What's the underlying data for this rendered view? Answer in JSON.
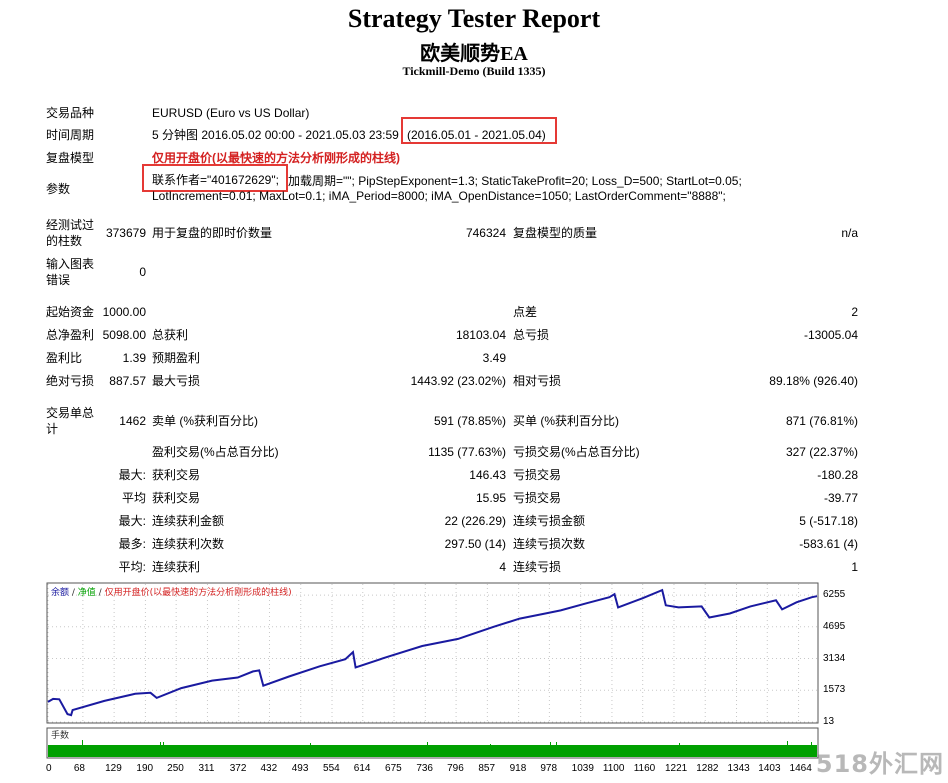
{
  "header": {
    "title": "Strategy Tester Report",
    "subtitle": "欧美顺势EA",
    "server": "Tickmill-Demo (Build 1335)"
  },
  "info": {
    "symbol_label": "交易品种",
    "symbol_value": "EURUSD (Euro vs US Dollar)",
    "period_label": "时间周期",
    "period_value": "5 分钟图 2016.05.02 00:00 - 2021.05.03 23:59",
    "period_highlight": "(2016.05.01 - 2021.05.04)",
    "model_label": "复盘模型",
    "model_value": "仅用开盘价(以最快速的方法分析刚形成的柱线)",
    "params_label": "参数",
    "params_highlight": "联系作者=\"401672629\";",
    "params_line1": "加载周期=\"\"; PipStepExponent=1.3; StaticTakeProfit=20; Loss_D=500; StartLot=0.05;",
    "params_line2": "LotIncrement=0.01; MaxLot=0.1; iMA_Period=8000; iMA_OpenDistance=1050; LastOrderComment=\"8888\";"
  },
  "bars": {
    "bars_label_1": "经测试过",
    "bars_label_2": "的柱数",
    "bars_value": "373679",
    "ticks_label": "用于复盘的即时价数量",
    "ticks_value": "746324",
    "quality_label": "复盘模型的质量",
    "quality_value": "n/a",
    "errors_label_1": "输入图表",
    "errors_label_2": "错误",
    "errors_value": "0"
  },
  "stats": {
    "deposit_label": "起始资金",
    "deposit_value": "1000.00",
    "spread_label": "点差",
    "spread_value": "2",
    "net_label": "总净盈利",
    "net_value": "5098.00",
    "gross_profit_label": "总获利",
    "gross_profit_value": "18103.04",
    "gross_loss_label": "总亏损",
    "gross_loss_value": "-13005.04",
    "pf_label": "盈利比",
    "pf_value": "1.39",
    "payoff_label": "预期盈利",
    "payoff_value": "3.49",
    "abs_dd_label": "绝对亏损",
    "abs_dd_value": "887.57",
    "max_dd_label": "最大亏损",
    "max_dd_value": "1443.92 (23.02%)",
    "rel_dd_label": "相对亏损",
    "rel_dd_value": "89.18% (926.40)"
  },
  "trades": {
    "total_label_1": "交易单总",
    "total_label_2": "计",
    "total_value": "1462",
    "short_label": "卖单 (%获利百分比)",
    "short_value": "591 (78.85%)",
    "long_label": "买单 (%获利百分比)",
    "long_value": "871 (76.81%)",
    "profit_trades_label": "盈利交易(%占总百分比)",
    "profit_trades_value": "1135 (77.63%)",
    "loss_trades_label": "亏损交易(%占总百分比)",
    "loss_trades_value": "327 (22.37%)",
    "largest_prefix": "最大:",
    "largest_profit_label": "获利交易",
    "largest_profit_value": "146.43",
    "largest_loss_label": "亏损交易",
    "largest_loss_value": "-180.28",
    "average_prefix": "平均",
    "average_profit_label": "获利交易",
    "average_profit_value": "15.95",
    "average_loss_label": "亏损交易",
    "average_loss_value": "-39.77",
    "max_prefix": "最大:",
    "max_consec_wins_label": "连续获利金额",
    "max_consec_wins_value": "22 (226.29)",
    "max_consec_losses_label": "连续亏损金额",
    "max_consec_losses_value": "5 (-517.18)",
    "most_prefix": "最多:",
    "max_consec_profit_label": "连续获利次数",
    "max_consec_profit_value": "297.50 (14)",
    "max_consec_loss_label": "连续亏损次数",
    "max_consec_loss_value": "-583.61 (4)",
    "avg_prefix": "平均:",
    "avg_consec_wins_label": "连续获利",
    "avg_consec_wins_value": "4",
    "avg_consec_losses_label": "连续亏损",
    "avg_consec_losses_value": "1"
  },
  "chart_legend": {
    "balance": "余额",
    "sep1": " / ",
    "equity": "净值",
    "sep2": " / ",
    "model": "仅用开盘价(以最快速的方法分析刚形成的柱线)",
    "volume_label": "手数"
  },
  "colors": {
    "balance_line": "#1a1aa0",
    "volume_bar": "#00a000",
    "legend_red": "#d42222",
    "highlight": "#e53935"
  },
  "watermark": "518外汇网",
  "chart_data": {
    "type": "line",
    "ylim": [
      13,
      6800
    ],
    "y_ticks": [
      6255,
      4695,
      3134,
      1573,
      13
    ],
    "x_ticks": [
      0,
      68,
      129,
      190,
      250,
      311,
      372,
      432,
      493,
      554,
      614,
      675,
      736,
      796,
      857,
      918,
      978,
      1039,
      1100,
      1160,
      1221,
      1282,
      1343,
      1403,
      1464
    ],
    "xlim": [
      0,
      1500
    ],
    "series": [
      {
        "name": "余额",
        "points": [
          [
            0,
            1000
          ],
          [
            10,
            1150
          ],
          [
            22,
            1130
          ],
          [
            38,
            400
          ],
          [
            45,
            350
          ],
          [
            48,
            600
          ],
          [
            110,
            1050
          ],
          [
            170,
            1400
          ],
          [
            200,
            1450
          ],
          [
            212,
            1200
          ],
          [
            260,
            1680
          ],
          [
            320,
            2050
          ],
          [
            370,
            2200
          ],
          [
            400,
            2500
          ],
          [
            412,
            2550
          ],
          [
            420,
            1800
          ],
          [
            470,
            2250
          ],
          [
            530,
            2750
          ],
          [
            580,
            3100
          ],
          [
            595,
            3450
          ],
          [
            600,
            2700
          ],
          [
            660,
            3200
          ],
          [
            730,
            3750
          ],
          [
            800,
            4100
          ],
          [
            870,
            4700
          ],
          [
            920,
            5100
          ],
          [
            970,
            5350
          ],
          [
            1000,
            5500
          ],
          [
            1050,
            5850
          ],
          [
            1095,
            6150
          ],
          [
            1105,
            6300
          ],
          [
            1112,
            5650
          ],
          [
            1160,
            6100
          ],
          [
            1198,
            6500
          ],
          [
            1205,
            5750
          ],
          [
            1230,
            5650
          ],
          [
            1275,
            5700
          ],
          [
            1290,
            5150
          ],
          [
            1330,
            5350
          ],
          [
            1370,
            5700
          ],
          [
            1420,
            6000
          ],
          [
            1432,
            5550
          ],
          [
            1460,
            5900
          ],
          [
            1490,
            6150
          ],
          [
            1500,
            6200
          ]
        ]
      }
    ]
  }
}
